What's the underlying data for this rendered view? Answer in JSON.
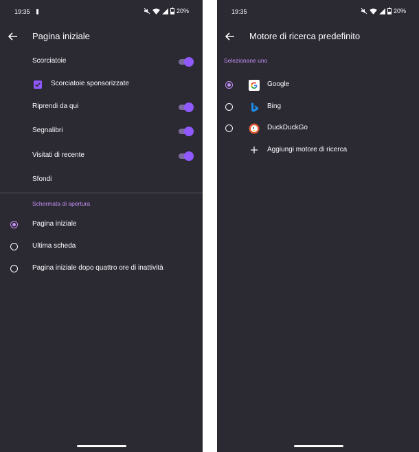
{
  "status_bar": {
    "time": "19:35",
    "battery": "20%"
  },
  "left_screen": {
    "title": "Pagina iniziale",
    "items": [
      {
        "label": "Scorciatoie",
        "toggle_on": true
      },
      {
        "label": "Scorciatoie sponsorizzate",
        "checked": true
      },
      {
        "label": "Riprendi da qui",
        "toggle_on": true
      },
      {
        "label": "Segnalibri",
        "toggle_on": true
      },
      {
        "label": "Visitati di recente",
        "toggle_on": true
      },
      {
        "label": "Sfondi"
      }
    ],
    "section_title": "Schermata di apertura",
    "radio_options": [
      {
        "label": "Pagina iniziale",
        "selected": true
      },
      {
        "label": "Ultima scheda",
        "selected": false
      },
      {
        "label": "Pagina iniziale dopo quattro ore di inattività",
        "selected": false
      }
    ]
  },
  "right_screen": {
    "title": "Motore di ricerca predefinito",
    "section_title": "Selezionane uno",
    "engines": [
      {
        "label": "Google",
        "selected": true,
        "icon": "google-icon"
      },
      {
        "label": "Bing",
        "selected": false,
        "icon": "bing-icon"
      },
      {
        "label": "DuckDuckGo",
        "selected": false,
        "icon": "duckduckgo-icon"
      }
    ],
    "add_engine_label": "Aggiungi motore di ricerca"
  },
  "colors": {
    "background": "#2b2a33",
    "accent": "#9059ff",
    "accent_light": "#c48ff5",
    "text": "#fbfbfe"
  }
}
